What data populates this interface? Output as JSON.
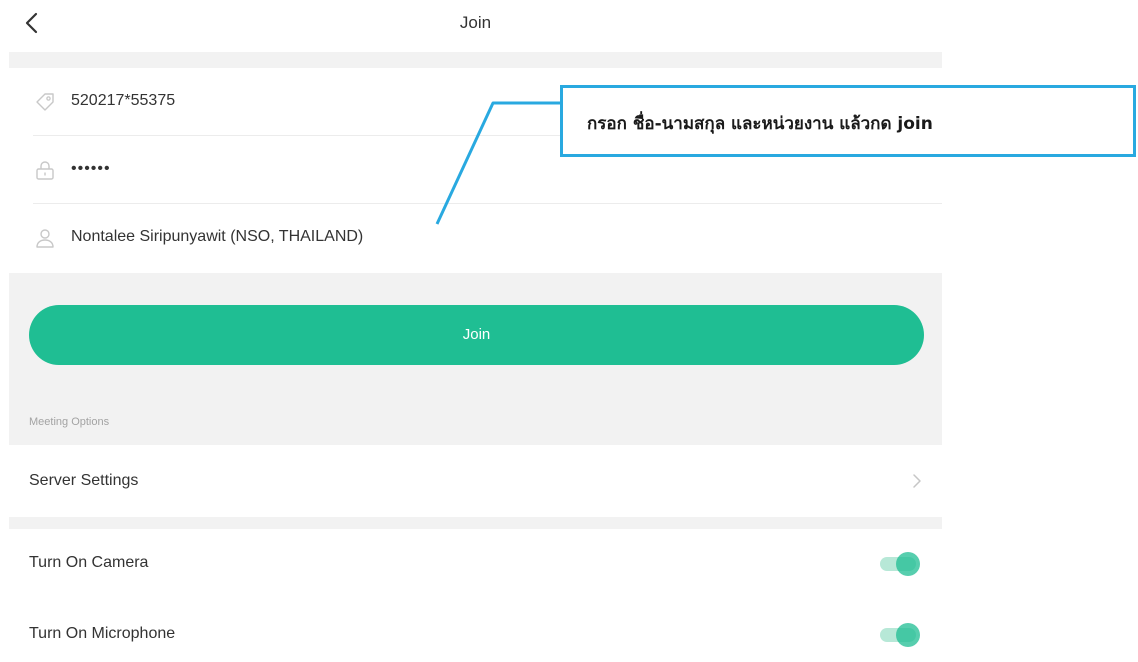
{
  "header": {
    "title": "Join",
    "back_icon": "chevron-left-icon"
  },
  "form": {
    "meeting_id": {
      "value": "520217*55375",
      "icon": "tag-icon"
    },
    "password": {
      "value": "••••••",
      "icon": "lock-icon"
    },
    "display_name": {
      "value": "Nontalee Siripunyawit (NSO, THAILAND)",
      "icon": "person-icon"
    }
  },
  "join_button": {
    "label": "Join"
  },
  "meeting_options": {
    "section_label": "Meeting Options",
    "server_settings_label": "Server Settings",
    "camera_label": "Turn On Camera",
    "camera_on": true,
    "microphone_label": "Turn On Microphone",
    "microphone_on": true
  },
  "annotation": {
    "text": "กรอก ชื่อ-นามสกุล และหน่วยงาน แล้วกด join"
  },
  "colors": {
    "accent": "#1fbe93",
    "callout_border": "#29a9e0",
    "section_bg": "#f2f2f2"
  }
}
